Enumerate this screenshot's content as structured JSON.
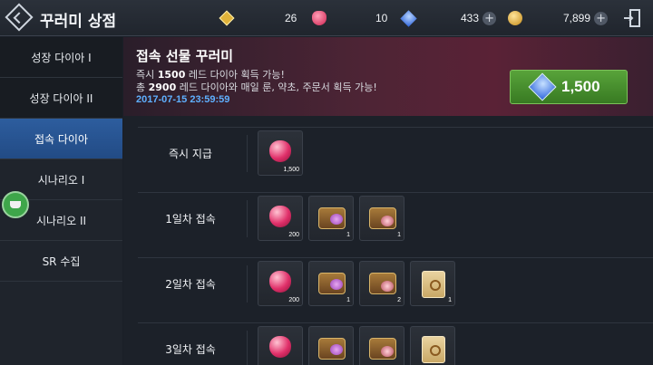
{
  "header": {
    "title": "꾸러미 상점",
    "resources": [
      {
        "icon": "gold-gem-icon",
        "value": "26"
      },
      {
        "icon": "red-diamond-icon",
        "value": "10"
      },
      {
        "icon": "blue-diamond-icon",
        "value": "433"
      },
      {
        "icon": "gold-coin-icon",
        "value": "7,899"
      }
    ]
  },
  "sidebar": {
    "items": [
      {
        "label": "성장 다이아 I"
      },
      {
        "label": "성장 다이아 II"
      },
      {
        "label": "접속 다이아"
      },
      {
        "label": "시나리오 I"
      },
      {
        "label": "시나리오 II"
      },
      {
        "label": "SR 수집"
      }
    ],
    "active_index": 2
  },
  "banner": {
    "title": "접속 선물 꾸러미",
    "line1_prefix": "즉시 ",
    "line1_amount": "1500",
    "line1_suffix": " 레드 다이아 획득 가능!",
    "line2_prefix": "총 ",
    "line2_amount": "2900",
    "line2_suffix": " 레드 다이아와 매일 룬, 약초, 주문서 획득 가능!",
    "date": "2017-07-15 23:59:59",
    "price": "1,500",
    "price_icon": "blue-diamond-icon"
  },
  "rewards": [
    {
      "label": "즉시 지급",
      "items": [
        {
          "icon": "red-diamond-icon",
          "qty": "1,500"
        }
      ]
    },
    {
      "label": "1일차 접속",
      "items": [
        {
          "icon": "red-diamond-icon",
          "qty": "200"
        },
        {
          "icon": "rune-chest-icon",
          "qty": "1"
        },
        {
          "icon": "herb-chest-icon",
          "qty": "1"
        }
      ]
    },
    {
      "label": "2일차 접속",
      "items": [
        {
          "icon": "red-diamond-icon",
          "qty": "200"
        },
        {
          "icon": "rune-chest-icon",
          "qty": "1"
        },
        {
          "icon": "herb-chest-icon",
          "qty": "2"
        },
        {
          "icon": "scroll-icon",
          "qty": "1"
        }
      ]
    },
    {
      "label": "3일차 접속",
      "items": [
        {
          "icon": "red-diamond-icon",
          "qty": ""
        },
        {
          "icon": "rune-chest-icon",
          "qty": ""
        },
        {
          "icon": "herb-chest-icon",
          "qty": ""
        },
        {
          "icon": "scroll-icon",
          "qty": ""
        }
      ]
    }
  ]
}
